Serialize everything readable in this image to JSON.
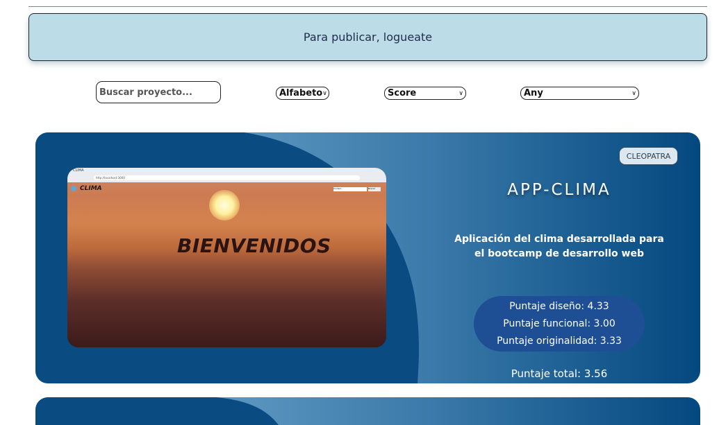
{
  "banner": {
    "text": "Para publicar, logueate"
  },
  "filters": {
    "search_placeholder": "Buscar proyecto...",
    "sort_alpha": "Alfabeto",
    "sort_score": "Score",
    "category": "Any"
  },
  "project": {
    "owner": "CLEOPATRA",
    "title": "APP-CLIMA",
    "description": "Aplicación del clima desarrollada para el bootcamp de desarrollo web",
    "scores": {
      "design": "Puntaje diseño: 4.33",
      "functional": "Puntaje funcional: 3.00",
      "originality": "Puntaje originalidad: 3.33"
    },
    "total": "Puntaje total: 3.56",
    "screenshot": {
      "browser_tab": "CLIMA",
      "url": "http://localhost:3000",
      "logo": "CLIMA",
      "hero": "BIENVENIDOS",
      "search_placeholder": "Ciudad...",
      "button": "Buscar"
    }
  },
  "colors": {
    "banner_bg": "#bcdde8",
    "card_dark": "#03487f",
    "card_light": "#7db2d6",
    "scores_bg": "#1e4f94"
  }
}
